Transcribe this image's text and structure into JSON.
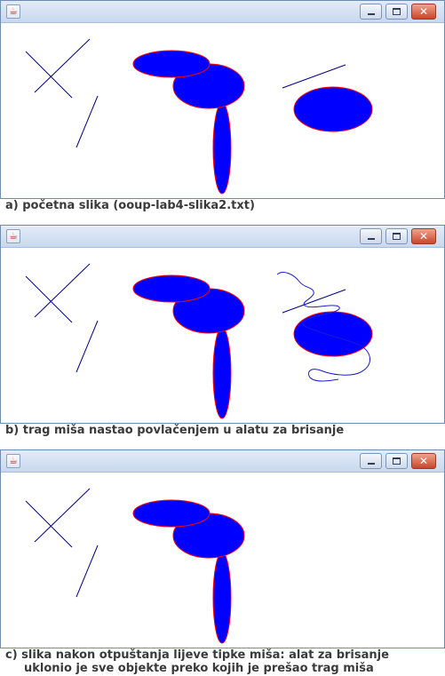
{
  "window_icon": "java-icon",
  "panels": [
    {
      "caption": "a) početna slika (ooup-lab4-slika2.txt)"
    },
    {
      "caption": "b) trag miša nastao povlačenjem u alatu za brisanje"
    },
    {
      "caption_line1": "c) slika nakon otpuštanja lijeve tipke miša: alat za brisanje",
      "caption_line2": "uklonio je sve objekte preko kojih je prešao trag miša"
    }
  ],
  "colors": {
    "shape_fill": "#0000ff",
    "shape_outline": "#ff0000",
    "line": "#00008b"
  }
}
